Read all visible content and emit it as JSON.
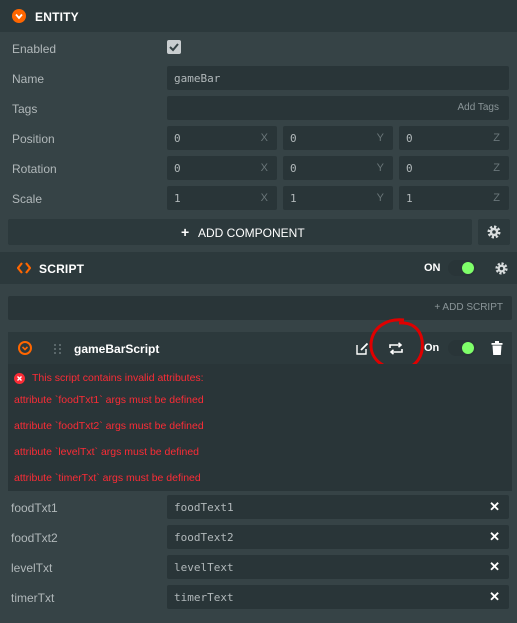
{
  "entity": {
    "title": "ENTITY",
    "enabled_label": "Enabled",
    "name_label": "Name",
    "name_value": "gameBar",
    "tags_label": "Tags",
    "tags_placeholder": "Add Tags",
    "position_label": "Position",
    "position": {
      "x": "0",
      "y": "0",
      "z": "0"
    },
    "rotation_label": "Rotation",
    "rotation": {
      "x": "0",
      "y": "0",
      "z": "0"
    },
    "scale_label": "Scale",
    "scale": {
      "x": "1",
      "y": "1",
      "z": "1"
    },
    "axes": {
      "x": "X",
      "y": "Y",
      "z": "Z"
    },
    "add_component_label": "ADD COMPONENT"
  },
  "script": {
    "title": "SCRIPT",
    "on_label": "ON",
    "add_script_label": "+ ADD SCRIPT",
    "item": {
      "name": "gameBarScript",
      "on_label": "On",
      "error_title": "This script contains invalid attributes:",
      "errors": [
        "attribute `foodTxt1` args must be defined",
        "attribute `foodTxt2` args must be defined",
        "attribute `levelTxt` args must be defined",
        "attribute `timerTxt` args must be defined"
      ]
    },
    "attributes": [
      {
        "label": "foodTxt1",
        "value": "foodText1"
      },
      {
        "label": "foodTxt2",
        "value": "foodText2"
      },
      {
        "label": "levelTxt",
        "value": "levelText"
      },
      {
        "label": "timerTxt",
        "value": "timerText"
      }
    ]
  },
  "colors": {
    "accent": "#f60",
    "toggle_on": "#7fff6a",
    "error": "#fb2c36",
    "annotation": "#e00000"
  }
}
